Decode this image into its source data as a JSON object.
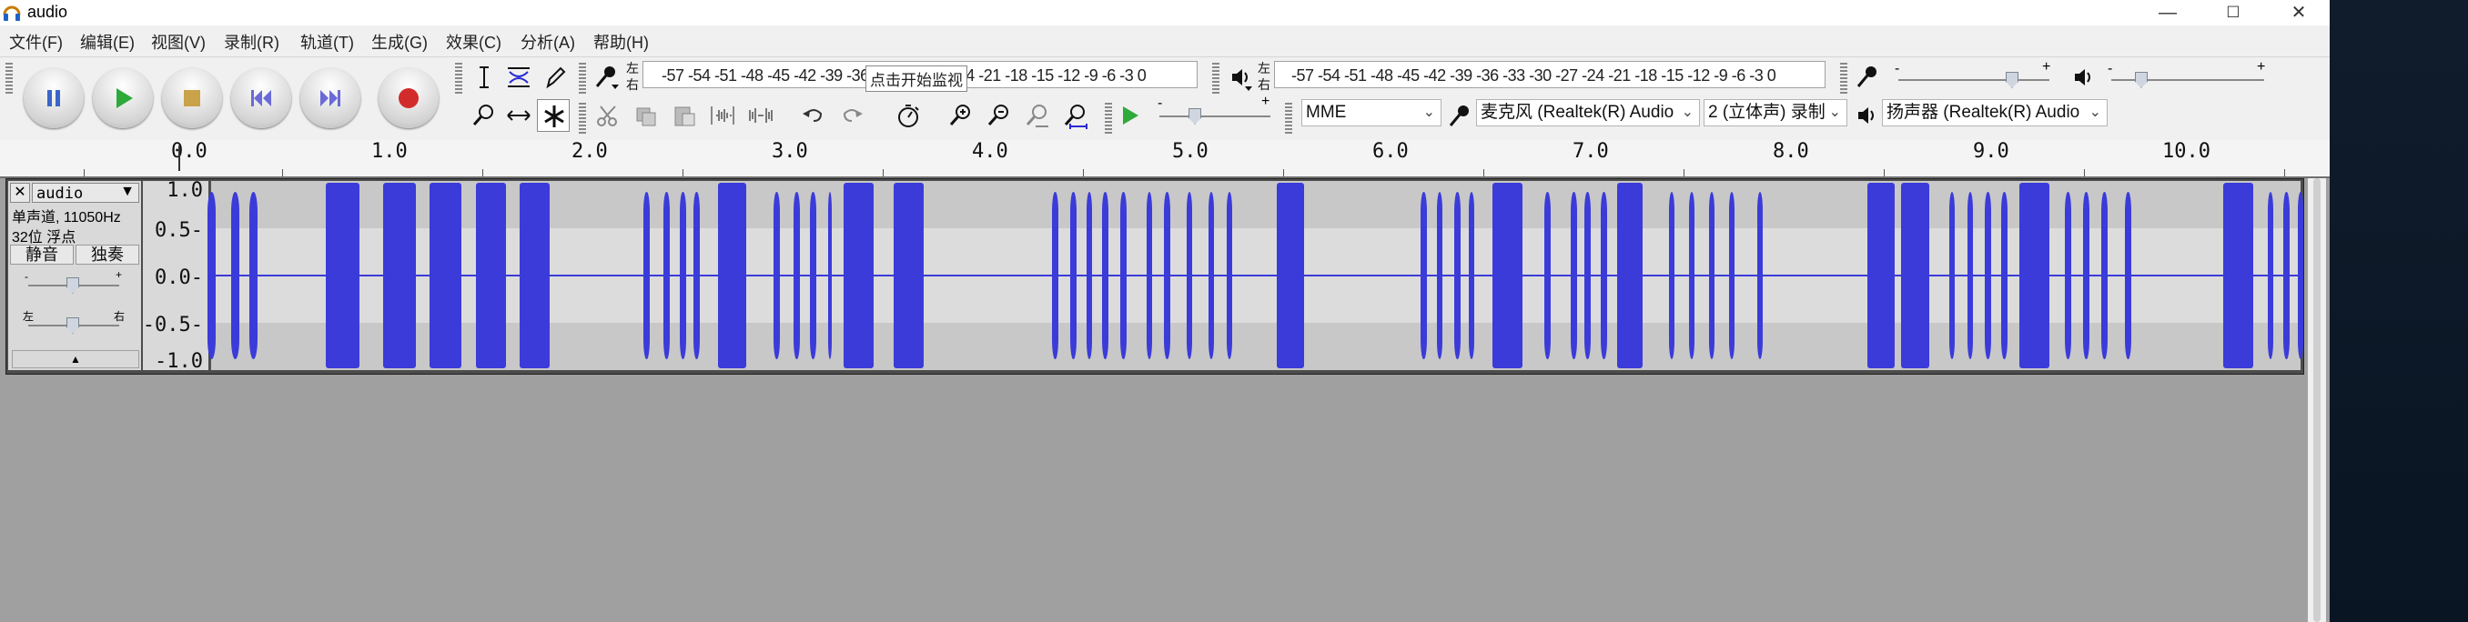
{
  "window": {
    "title": "audio",
    "min": "—",
    "max": "☐",
    "close": "✕"
  },
  "menu": [
    "文件(F)",
    "编辑(E)",
    "视图(V)",
    "录制(R)",
    "轨道(T)",
    "生成(G)",
    "效果(C)",
    "分析(A)",
    "帮助(H)"
  ],
  "recording_meter": {
    "lr_top": "左",
    "lr_bottom": "右",
    "scale": "-57 -54 -51 -48 -45 -42 -39 -36 -33 -30 -27 -24 -21 -18 -15 -12  -9  -6  -3  0",
    "monitor_label": "点击开始监视"
  },
  "playback_meter": {
    "lr_top": "左",
    "lr_bottom": "右",
    "scale": "-57 -54 -51 -48 -45 -42 -39 -36 -33 -30 -27 -24 -21 -18 -15 -12  -9  -6  -3  0"
  },
  "mixer": {
    "minus": "-",
    "plus": "+"
  },
  "device": {
    "host": "MME",
    "mic": "麦克风 (Realtek(R) Audio",
    "channels": "2 (立体声) 录制",
    "speaker": "扬声器 (Realtek(R) Audio"
  },
  "ruler": {
    "ticks": [
      "0.0",
      "1.0",
      "2.0",
      "3.0",
      "4.0",
      "5.0",
      "6.0",
      "7.0",
      "8.0",
      "9.0",
      "10.0"
    ]
  },
  "track": {
    "name": "audio",
    "info_line1": "单声道, 11050Hz",
    "info_line2": "32位 浮点",
    "mute": "静音",
    "solo": "独奏",
    "gain_minus": "-",
    "gain_plus": "+",
    "pan_left": "左",
    "pan_right": "右",
    "scale": [
      "1.0",
      "0.5-",
      "0.0-",
      "-0.5-",
      "-1.0"
    ],
    "clips": [
      [
        0.14,
        0.18
      ],
      [
        0.26,
        0.3
      ],
      [
        0.35,
        0.39
      ],
      [
        0.73,
        0.9
      ],
      [
        1.02,
        1.18
      ],
      [
        1.25,
        1.41
      ],
      [
        1.48,
        1.63
      ],
      [
        1.7,
        1.85
      ],
      [
        2.32,
        2.35
      ],
      [
        2.42,
        2.45
      ],
      [
        2.5,
        2.53
      ],
      [
        2.57,
        2.6
      ],
      [
        2.69,
        2.83
      ],
      [
        2.97,
        3.0
      ],
      [
        3.07,
        3.1
      ],
      [
        3.15,
        3.18
      ],
      [
        3.24,
        3.26
      ],
      [
        3.32,
        3.47
      ],
      [
        3.57,
        3.72
      ],
      [
        4.36,
        4.39
      ],
      [
        4.45,
        4.48
      ],
      [
        4.53,
        4.56
      ],
      [
        4.61,
        4.64
      ],
      [
        4.7,
        4.73
      ],
      [
        4.83,
        4.86
      ],
      [
        4.92,
        4.95
      ],
      [
        5.03,
        5.06
      ],
      [
        5.14,
        5.17
      ],
      [
        5.23,
        5.26
      ],
      [
        5.48,
        5.62
      ],
      [
        6.2,
        6.23
      ],
      [
        6.28,
        6.31
      ],
      [
        6.37,
        6.4
      ],
      [
        6.44,
        6.47
      ],
      [
        6.56,
        6.71
      ],
      [
        6.82,
        6.85
      ],
      [
        6.95,
        6.98
      ],
      [
        7.02,
        7.05
      ],
      [
        7.1,
        7.13
      ],
      [
        7.18,
        7.31
      ],
      [
        7.44,
        7.47
      ],
      [
        7.54,
        7.57
      ],
      [
        7.64,
        7.67
      ],
      [
        7.74,
        7.77
      ],
      [
        7.88,
        7.91
      ],
      [
        8.43,
        8.57
      ],
      [
        8.6,
        8.74
      ],
      [
        8.84,
        8.87
      ],
      [
        8.93,
        8.96
      ],
      [
        9.02,
        9.05
      ],
      [
        9.1,
        9.13
      ],
      [
        9.19,
        9.34
      ],
      [
        9.42,
        9.45
      ],
      [
        9.51,
        9.54
      ],
      [
        9.6,
        9.63
      ],
      [
        9.72,
        9.75
      ],
      [
        10.21,
        10.36
      ],
      [
        10.43,
        10.46
      ],
      [
        10.51,
        10.54
      ],
      [
        10.58,
        10.61
      ]
    ]
  },
  "colors": {
    "wave": "#3b3bd9",
    "track_bg": "#c8c8c8",
    "app_bg": "#a0a0a0"
  }
}
